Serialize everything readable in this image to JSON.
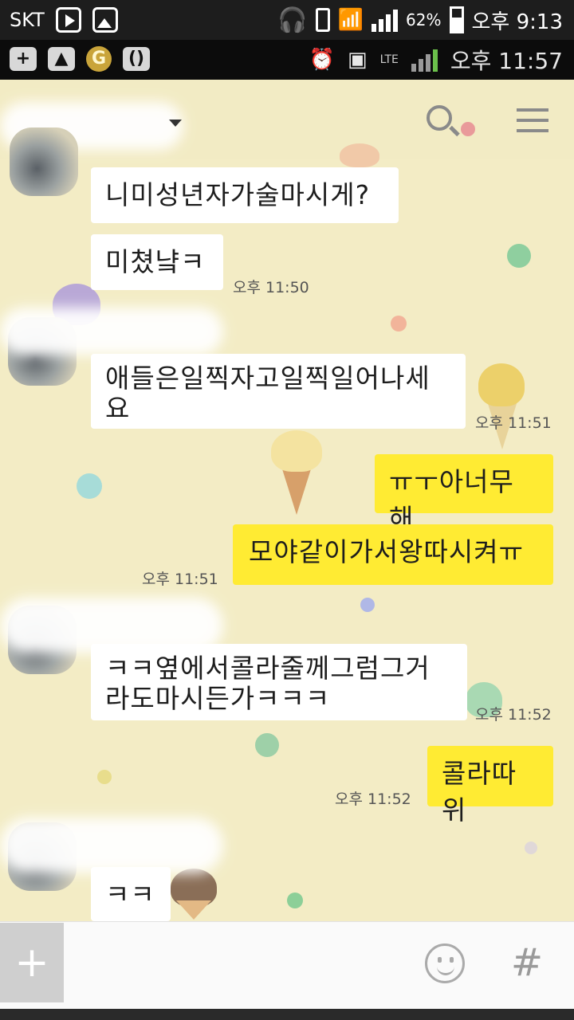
{
  "status_bar": {
    "carrier": "SKT",
    "battery": "62%",
    "time": "오후 9:13"
  },
  "inner_status_bar": {
    "network": "LTE",
    "time": "오후 11:57"
  },
  "chat_header": {
    "chat_name": "",
    "icons": [
      "search-icon",
      "menu-icon",
      "chevron-down-icon"
    ]
  },
  "messages": [
    {
      "side": "in",
      "text": "니미성년자가술마시게?"
    },
    {
      "side": "in",
      "text": "미쳤냨ㅋ",
      "time": "오후 11:50"
    },
    {
      "side": "in",
      "text": "애들은일찍자고일찍일어나세\n요",
      "time": "오후 11:51"
    },
    {
      "side": "out",
      "text": "ㅠㅜ아너무해"
    },
    {
      "side": "out",
      "text": "모야같이가서왕따시켜ㅠ",
      "time": "오후 11:51"
    },
    {
      "side": "in",
      "text": "ㅋㅋ옆에서콜라줄께그럼그거\n라도마시든가ㅋㅋㅋ",
      "time": "오후 11:52"
    },
    {
      "side": "out",
      "text": "콜라따위",
      "time": "오후 11:52"
    },
    {
      "side": "in",
      "text": "ㅋㅋ"
    }
  ],
  "input_bar": {
    "plus_label": "+",
    "hash_label": "#",
    "text_value": ""
  },
  "colors": {
    "background": "#f3ecc5",
    "incoming_bubble": "#ffffff",
    "outgoing_bubble": "#ffeb33"
  }
}
